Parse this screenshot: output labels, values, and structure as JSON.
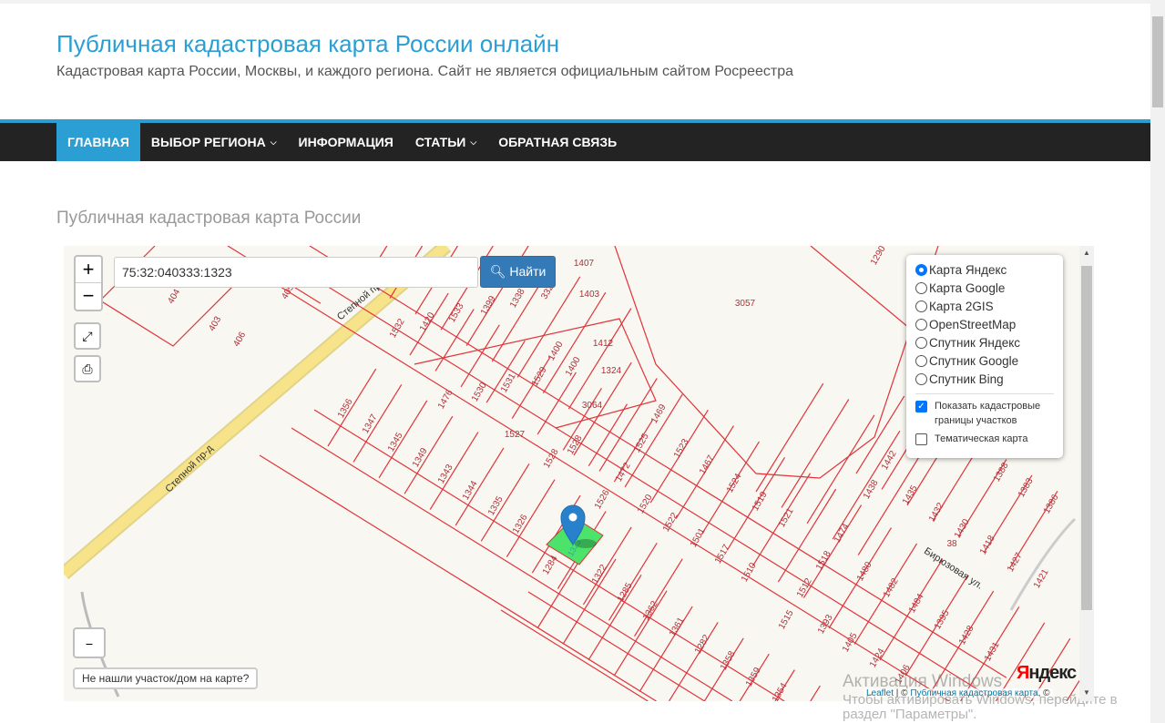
{
  "site": {
    "title": "Публичная кадастровая карта России онлайн",
    "subtitle": "Кадастровая карта России, Москвы, и каждого региона. Сайт не является официальным сайтом Росреестра"
  },
  "nav": [
    {
      "label": "ГЛАВНАЯ"
    },
    {
      "label": "ВЫБОР РЕГИОНА",
      "dropdown": true
    },
    {
      "label": "ИНФОРМАЦИЯ"
    },
    {
      "label": "СТАТЬИ",
      "dropdown": true
    },
    {
      "label": "ОБРАТНАЯ СВЯЗЬ"
    }
  ],
  "page_heading": "Публичная кадастровая карта России",
  "map": {
    "zoom_in": "+",
    "zoom_out": "−",
    "search_value": "75:32:040333:1323",
    "search_button": "Найти",
    "layers": [
      "Карта Яндекс",
      "Карта Google",
      "Карта 2GIS",
      "OpenStreetMap",
      "Спутник Яндекс",
      "Спутник Google",
      "Спутник Bing"
    ],
    "selected_layer": "Карта Яндекс",
    "show_borders_label": "Показать кадастровые границы участков",
    "show_borders": true,
    "thematic_label": "Тематическая карта",
    "thematic": false,
    "not_found": "Не нашли участок/дом на карте?",
    "attribution": {
      "leaflet": "Leaflet",
      "sep": " | © ",
      "pkk": "Публичная кадастровая карта",
      "tail": ", ©"
    },
    "yandex_logo": "Яндекс",
    "streets": [
      "Степной пр-д",
      "Степной пр-д",
      "Бирюзовая ул."
    ],
    "selected_parcel": "1323",
    "parcels": [
      "404",
      "403",
      "406",
      "405",
      "1532",
      "1420",
      "1533",
      "1399",
      "1338",
      "332",
      "1407",
      "1403",
      "3057",
      "1290",
      "1412",
      "1400",
      "1400",
      "1324",
      "1476",
      "1530",
      "1531",
      "1529",
      "3064",
      "1527",
      "1356",
      "1347",
      "1345",
      "1349",
      "1343",
      "1344",
      "1335",
      "1326",
      "1528",
      "1528",
      "1469",
      "1525",
      "1523",
      "1472",
      "1467",
      "1526",
      "1520",
      "1524",
      "1519",
      "1522",
      "1521",
      "1501",
      "1517",
      "1510",
      "1474",
      "1518",
      "1480",
      "1512",
      "1482",
      "1515",
      "1393",
      "1484",
      "1405",
      "1395",
      "1424",
      "1428",
      "1406",
      "1431",
      "1284",
      "1322",
      "1285",
      "1362",
      "1361",
      "1282",
      "1358",
      "1359",
      "1354",
      "1442",
      "1438",
      "1435",
      "1432",
      "1430",
      "1418",
      "1427",
      "1388",
      "1383",
      "1386",
      "1421",
      "38"
    ],
    "colors": {
      "parcel_line": "#e0343a",
      "selected_fill": "#4be36a",
      "road": "#f7e48a",
      "marker": "#2a81cb"
    }
  },
  "watermark": {
    "title": "Активация Windows",
    "text": "Чтобы активировать Windows, перейдите в раздел \"Параметры\"."
  }
}
